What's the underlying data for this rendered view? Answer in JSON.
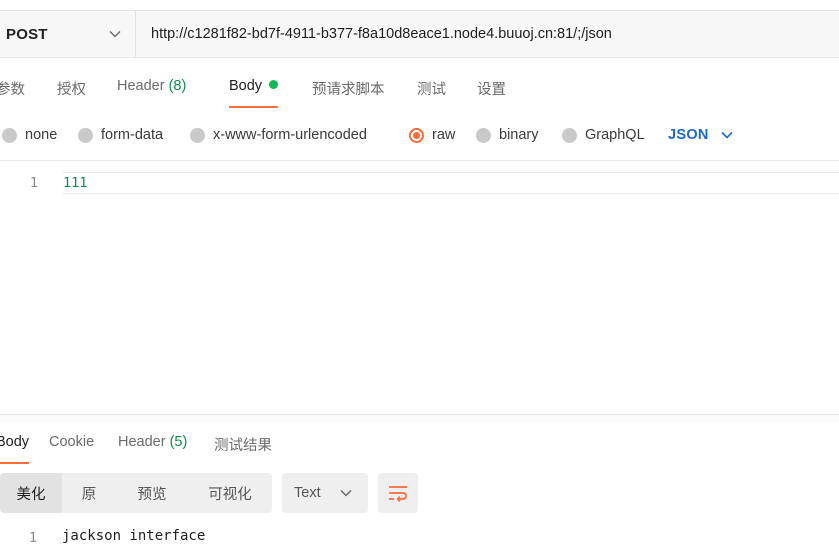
{
  "request": {
    "method": "POST",
    "url": "http://c1281f82-bd7f-4911-b377-f8a10d8eace1.node4.buuoj.cn:81/;/json"
  },
  "request_tabs": {
    "params": "参数",
    "auth": "授权",
    "headers": "Header",
    "headers_count": "(8)",
    "body": "Body",
    "pre_request": "预请求脚本",
    "tests": "测试",
    "settings": "设置"
  },
  "body_types": {
    "none": "none",
    "form_data": "form-data",
    "urlencoded": "x-www-form-urlencoded",
    "raw": "raw",
    "binary": "binary",
    "graphql": "GraphQL",
    "selected": "raw",
    "language": "JSON"
  },
  "request_body": {
    "line_number": "1",
    "content": "111"
  },
  "response_tabs": {
    "body": "Body",
    "cookies": "Cookie",
    "headers": "Header",
    "headers_count": "(5)",
    "test_results": "测试结果"
  },
  "response_view": {
    "pretty": "美化",
    "raw": "原",
    "preview": "预览",
    "visualize": "可视化",
    "format": "Text"
  },
  "response_body": {
    "line_number": "1",
    "content": "jackson interface"
  },
  "colors": {
    "accent": "#ff6c37",
    "green": "#0cbb52",
    "count_green": "#0f8e4e",
    "link_blue": "#1a66d6"
  }
}
